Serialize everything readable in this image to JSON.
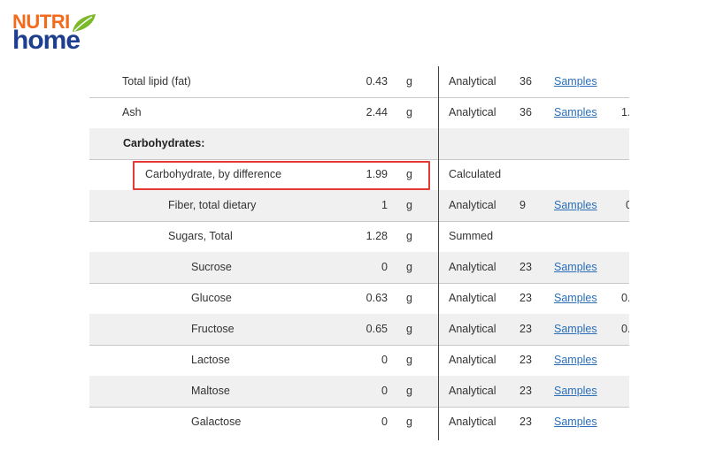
{
  "logo": {
    "line1": "NUTRI",
    "line2": "home",
    "colors": {
      "nutri": "#f26b1d",
      "home": "#1e3f8f",
      "leaf": "#7bb928"
    }
  },
  "rows": [
    {
      "name": "Total lipid (fat)",
      "value": "0.43",
      "unit": "g",
      "method": "Analytical",
      "count": "36",
      "samples": "Samples",
      "extra": ""
    },
    {
      "name": "Ash",
      "value": "2.44",
      "unit": "g",
      "method": "Analytical",
      "count": "36",
      "samples": "Samples",
      "extra": "1."
    },
    {
      "name": "Carbohydrates:",
      "value": "",
      "unit": "",
      "method": "",
      "count": "",
      "samples": "",
      "extra": ""
    },
    {
      "name": "Carbohydrate, by difference",
      "value": "1.99",
      "unit": "g",
      "method": "Calculated",
      "count": "",
      "samples": "",
      "extra": ""
    },
    {
      "name": "Fiber, total dietary",
      "value": "1",
      "unit": "g",
      "method": "Analytical",
      "count": "9",
      "samples": "Samples",
      "extra": "0"
    },
    {
      "name": "Sugars, Total",
      "value": "1.28",
      "unit": "g",
      "method": "Summed",
      "count": "",
      "samples": "",
      "extra": ""
    },
    {
      "name": "Sucrose",
      "value": "0",
      "unit": "g",
      "method": "Analytical",
      "count": "23",
      "samples": "Samples",
      "extra": ""
    },
    {
      "name": "Glucose",
      "value": "0.63",
      "unit": "g",
      "method": "Analytical",
      "count": "23",
      "samples": "Samples",
      "extra": "0."
    },
    {
      "name": "Fructose",
      "value": "0.65",
      "unit": "g",
      "method": "Analytical",
      "count": "23",
      "samples": "Samples",
      "extra": "0."
    },
    {
      "name": "Lactose",
      "value": "0",
      "unit": "g",
      "method": "Analytical",
      "count": "23",
      "samples": "Samples",
      "extra": ""
    },
    {
      "name": "Maltose",
      "value": "0",
      "unit": "g",
      "method": "Analytical",
      "count": "23",
      "samples": "Samples",
      "extra": ""
    },
    {
      "name": "Galactose",
      "value": "0",
      "unit": "g",
      "method": "Analytical",
      "count": "23",
      "samples": "Samples",
      "extra": ""
    }
  ],
  "highlight_color": "#e53935"
}
